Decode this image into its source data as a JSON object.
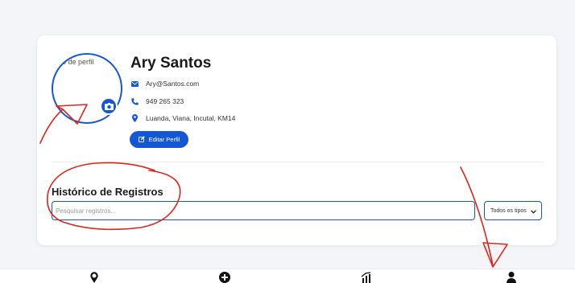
{
  "profile": {
    "photo_alt": "Foto de perfil",
    "name": "Ary Santos",
    "email": "Ary@Santos.com",
    "phone": "949 265 323",
    "address": "Luanda, Viana, Incutal, KM14",
    "edit_label": "Editar Perfil"
  },
  "history": {
    "title": "Histórico de Registros",
    "search_placeholder": "Pesquisar registros...",
    "filter_selected": "Todos os tipos"
  },
  "nav": {
    "items": [
      "map-marker-icon",
      "plus-circle-icon",
      "chart-icon",
      "user-icon"
    ]
  },
  "colors": {
    "accent": "#1457d6",
    "annotation": "#e0241b",
    "background": "#f4f5f9"
  }
}
